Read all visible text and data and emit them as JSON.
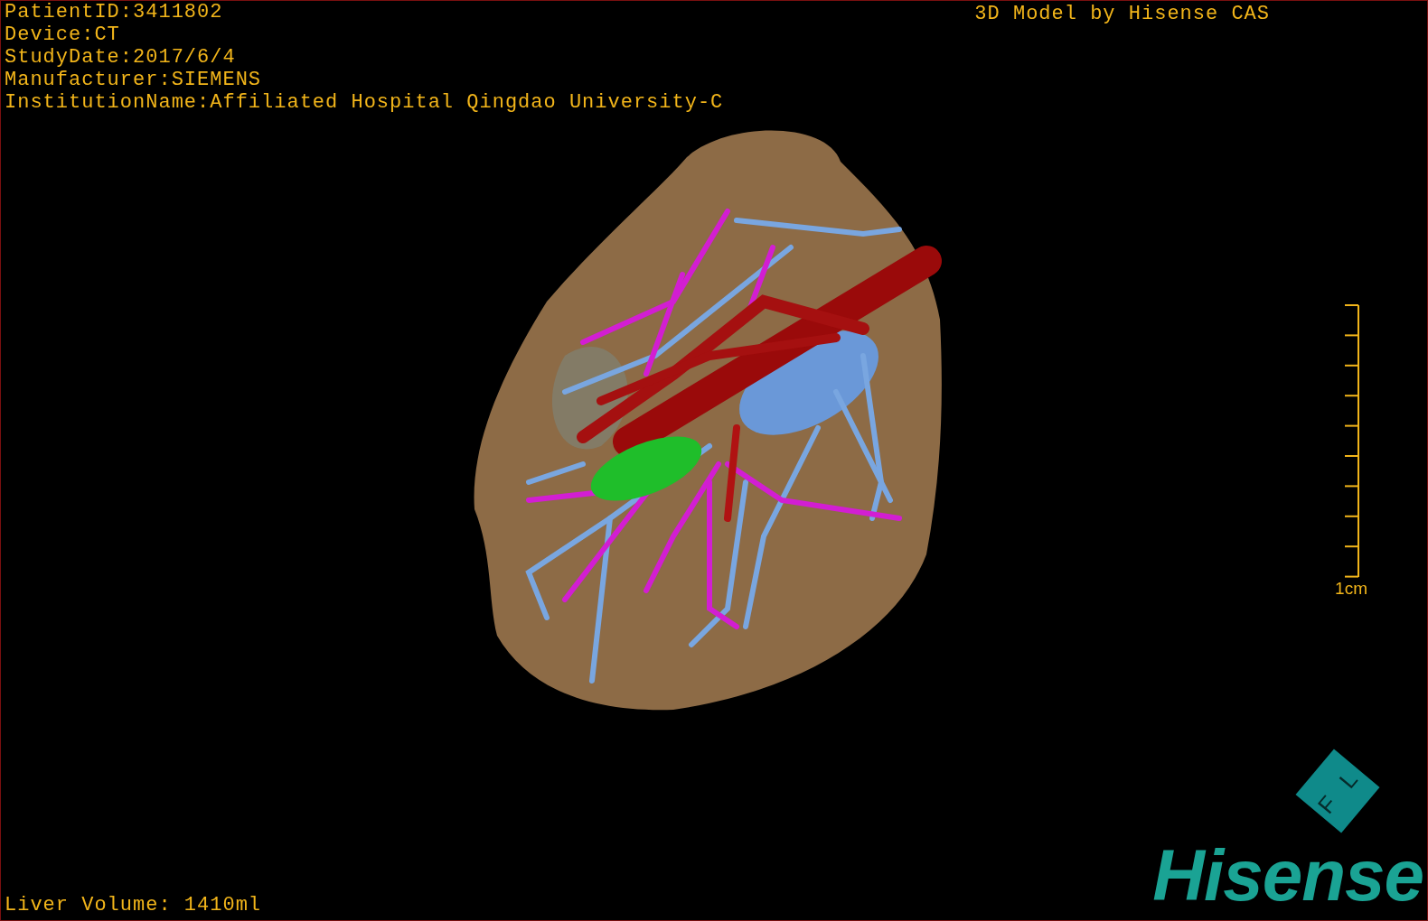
{
  "patient_info": [
    "PatientID:3411802",
    "Device:CT",
    "StudyDate:2017/6/4",
    "Manufacturer:SIEMENS",
    "InstitutionName:Affiliated Hospital Qingdao University-C"
  ],
  "title": "3D Model by Hisense CAS",
  "scale_bar": {
    "label": "1cm"
  },
  "measurement": "Liver Volume: 1410ml",
  "logo": {
    "mark_letters": [
      "F",
      "L"
    ],
    "wordmark": "Hisense"
  }
}
